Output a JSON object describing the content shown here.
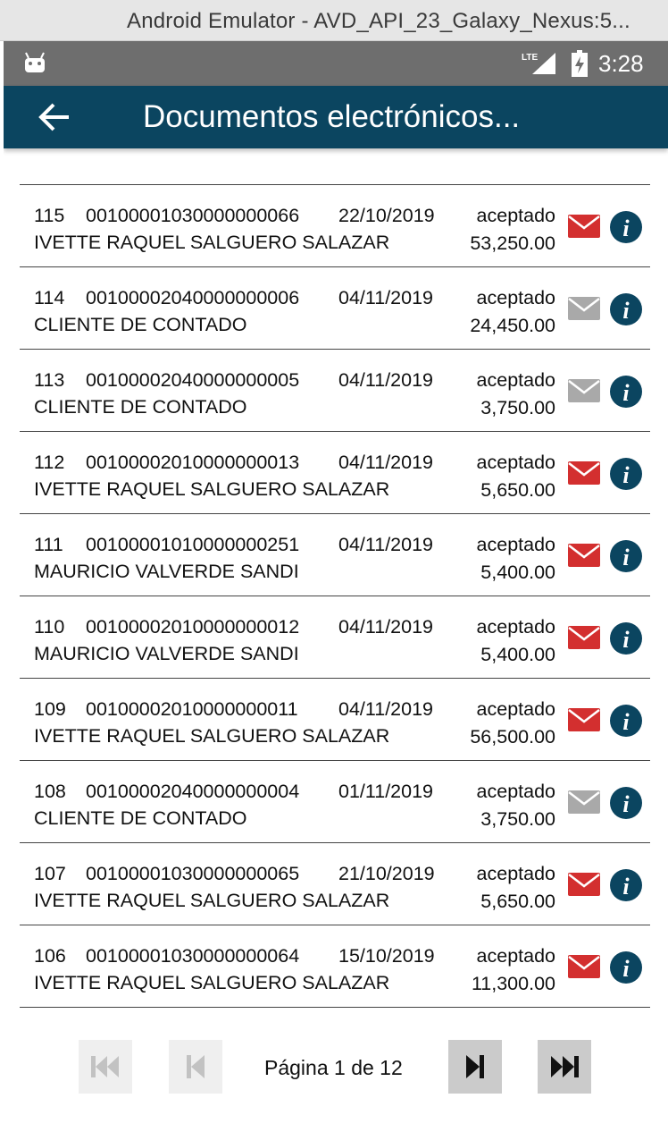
{
  "window": {
    "title": "Android Emulator - AVD_API_23_Galaxy_Nexus:5..."
  },
  "statusbar": {
    "network": "LTE",
    "time": "3:28"
  },
  "appbar": {
    "title": "Documentos electrónicos..."
  },
  "documents": [
    {
      "num": "115",
      "code": "00100001030000000066",
      "date": "22/10/2019",
      "status": "aceptado",
      "client": "IVETTE RAQUEL SALGUERO SALAZAR",
      "amount": "53,250.00",
      "mail_sent": true
    },
    {
      "num": "114",
      "code": "00100002040000000006",
      "date": "04/11/2019",
      "status": "aceptado",
      "client": "CLIENTE DE CONTADO",
      "amount": "24,450.00",
      "mail_sent": false
    },
    {
      "num": "113",
      "code": "00100002040000000005",
      "date": "04/11/2019",
      "status": "aceptado",
      "client": "CLIENTE DE CONTADO",
      "amount": "3,750.00",
      "mail_sent": false
    },
    {
      "num": "112",
      "code": "00100002010000000013",
      "date": "04/11/2019",
      "status": "aceptado",
      "client": "IVETTE RAQUEL SALGUERO SALAZAR",
      "amount": "5,650.00",
      "mail_sent": true
    },
    {
      "num": "111",
      "code": "00100001010000000251",
      "date": "04/11/2019",
      "status": "aceptado",
      "client": "MAURICIO VALVERDE SANDI",
      "amount": "5,400.00",
      "mail_sent": true
    },
    {
      "num": "110",
      "code": "00100002010000000012",
      "date": "04/11/2019",
      "status": "aceptado",
      "client": "MAURICIO VALVERDE SANDI",
      "amount": "5,400.00",
      "mail_sent": true
    },
    {
      "num": "109",
      "code": "00100002010000000011",
      "date": "04/11/2019",
      "status": "aceptado",
      "client": "IVETTE RAQUEL SALGUERO SALAZAR",
      "amount": "56,500.00",
      "mail_sent": true
    },
    {
      "num": "108",
      "code": "00100002040000000004",
      "date": "01/11/2019",
      "status": "aceptado",
      "client": "CLIENTE DE CONTADO",
      "amount": "3,750.00",
      "mail_sent": false
    },
    {
      "num": "107",
      "code": "00100001030000000065",
      "date": "21/10/2019",
      "status": "aceptado",
      "client": "IVETTE RAQUEL SALGUERO SALAZAR",
      "amount": "5,650.00",
      "mail_sent": true
    },
    {
      "num": "106",
      "code": "00100001030000000064",
      "date": "15/10/2019",
      "status": "aceptado",
      "client": "IVETTE RAQUEL SALGUERO SALAZAR",
      "amount": "11,300.00",
      "mail_sent": true
    }
  ],
  "pager": {
    "label": "Página 1 de 12",
    "first_enabled": false,
    "prev_enabled": false,
    "next_enabled": true,
    "last_enabled": true
  },
  "colors": {
    "appbar": "#0b4560",
    "mail_sent": "#d32f2f",
    "mail_unsent": "#a9a9a9",
    "info": "#0b4560",
    "statusbar": "#6e6e6e"
  },
  "icons": {
    "back": "arrow-back-icon",
    "mail": "envelope-icon",
    "info": "info-circle-icon",
    "first": "first-page-icon",
    "prev": "previous-page-icon",
    "next": "next-page-icon",
    "last": "last-page-icon"
  }
}
